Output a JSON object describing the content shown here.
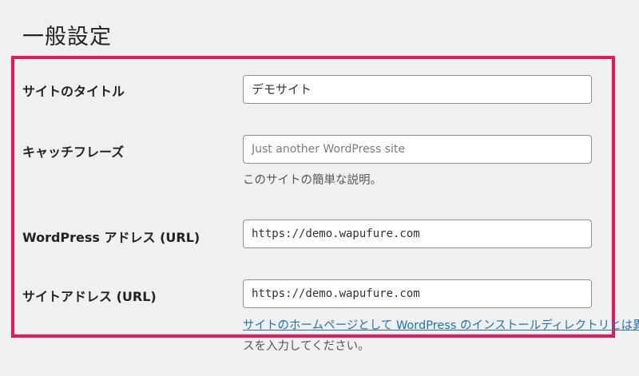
{
  "page": {
    "title": "一般設定"
  },
  "fields": {
    "site_title": {
      "label": "サイトのタイトル",
      "value": "デモサイト"
    },
    "tagline": {
      "label": "キャッチフレーズ",
      "placeholder": "Just another WordPress site",
      "description": "このサイトの簡単な説明。"
    },
    "wp_address": {
      "label_latin": "WordPress",
      "label_jp": "アドレス",
      "label_suffix": "(URL)",
      "value": "https://demo.wapufure.com"
    },
    "site_address": {
      "label_jp": "サイトアドレス",
      "label_suffix": "(URL)",
      "value": "https://demo.wapufure.com",
      "link_text": "サイトのホームページとして WordPress のインストールディレクトリとは異なる場所を設定する場合は、ここにアドレ",
      "description_tail": "スを入力してください。"
    }
  },
  "colors": {
    "highlight_border": "#e8175d",
    "link": "#2271b1",
    "background": "#f0f0f1"
  }
}
